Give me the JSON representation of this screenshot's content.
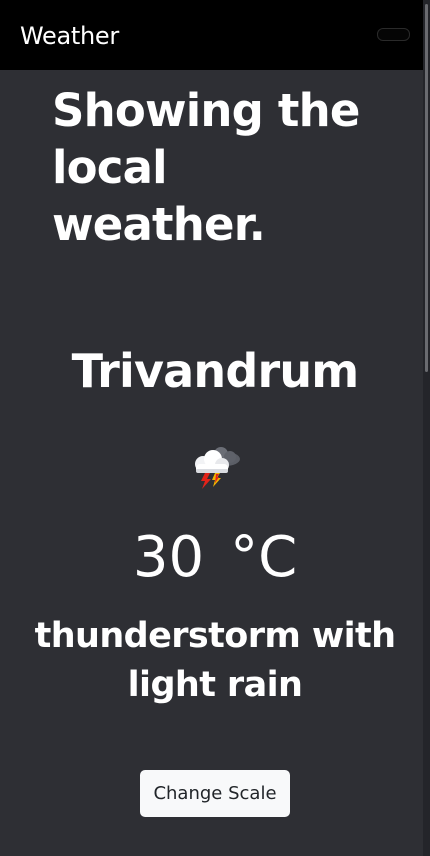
{
  "navbar": {
    "brand": "Weather"
  },
  "main": {
    "headline": "Showing the local weather.",
    "city": "Trivandrum",
    "weather_icon": "thunderstorm-rain-icon",
    "temperature": {
      "value": "30",
      "unit": "°C"
    },
    "description": "thunderstorm with light rain",
    "change_scale_label": "Change Scale"
  },
  "colors": {
    "background": "#2e2f34",
    "navbar": "#000000",
    "button": "#f8f9fa"
  }
}
